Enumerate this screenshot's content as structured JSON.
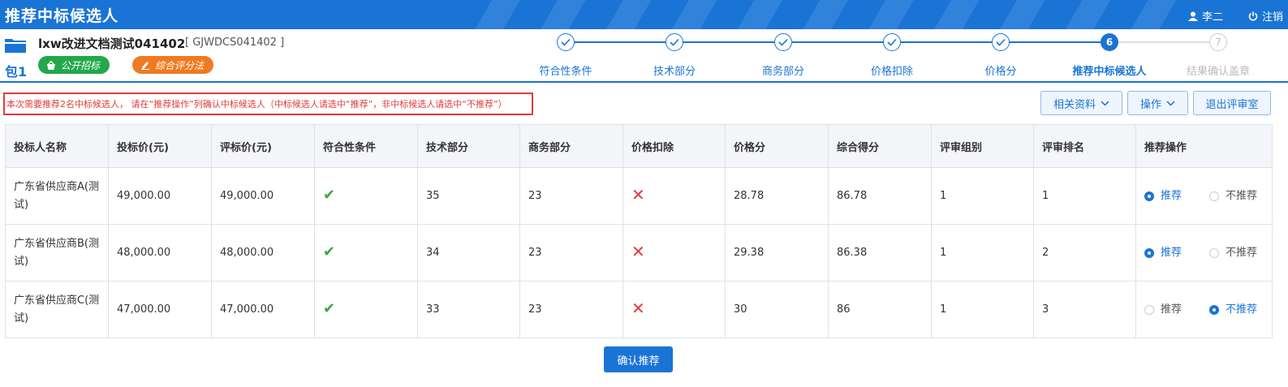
{
  "app": {
    "title": "推荐中标候选人",
    "user": "李二",
    "logout": "注销"
  },
  "project": {
    "name": "lxw改进文档测试041402",
    "code": "[ GJWDCS041402 ]",
    "package": "包1",
    "tags": [
      "公开招标",
      "综合评分法"
    ]
  },
  "steps": [
    {
      "label": "符合性条件",
      "state": "done"
    },
    {
      "label": "技术部分",
      "state": "done"
    },
    {
      "label": "商务部分",
      "state": "done"
    },
    {
      "label": "价格扣除",
      "state": "done"
    },
    {
      "label": "价格分",
      "state": "done"
    },
    {
      "label": "推荐中标候选人",
      "state": "active",
      "num": "6"
    },
    {
      "label": "结果确认盖章",
      "state": "todo",
      "num": "7"
    }
  ],
  "notice": "本次需要推荐2名中标候选人， 请在“推荐操作”列确认中标候选人（中标候选人请选中“推荐”，非中标候选人请选中“不推荐”）",
  "toolbar": {
    "materials": "相关资料",
    "operations": "操作",
    "exit": "退出评审室"
  },
  "table": {
    "headers": [
      "投标人名称",
      "投标价(元)",
      "评标价(元)",
      "符合性条件",
      "技术部分",
      "商务部分",
      "价格扣除",
      "价格分",
      "综合得分",
      "评审组别",
      "评审排名",
      "推荐操作"
    ],
    "rows": [
      {
        "name": "广东省供应商A(测试)",
        "bid": "49,000.00",
        "eval": "49,000.00",
        "tech": "35",
        "biz": "23",
        "price_score": "28.78",
        "total": "86.78",
        "group": "1",
        "rank": "1",
        "recommended": true
      },
      {
        "name": "广东省供应商B(测试)",
        "bid": "48,000.00",
        "eval": "48,000.00",
        "tech": "34",
        "biz": "23",
        "price_score": "29.38",
        "total": "86.38",
        "group": "1",
        "rank": "2",
        "recommended": true
      },
      {
        "name": "广东省供应商C(测试)",
        "bid": "47,000.00",
        "eval": "47,000.00",
        "tech": "33",
        "biz": "23",
        "price_score": "30",
        "total": "86",
        "group": "1",
        "rank": "3",
        "recommended": false
      }
    ],
    "recommend_label": "推荐",
    "not_recommend_label": "不推荐"
  },
  "confirm_button": "确认推荐",
  "colors": {
    "primary": "#1a74d6",
    "success": "#22a84a",
    "warn": "#f07a22",
    "danger": "#e23b3b"
  }
}
